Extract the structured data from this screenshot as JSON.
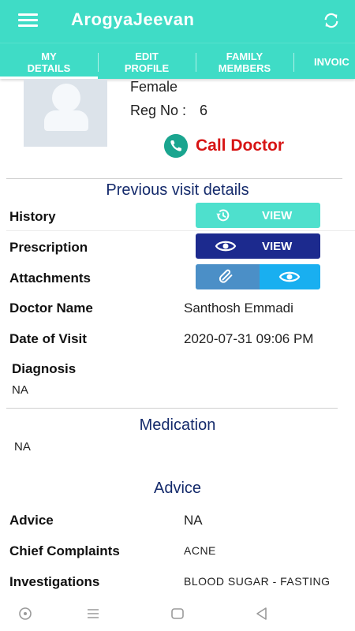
{
  "app": {
    "title": "ArogyaJeevan",
    "accent_color": "#3fdcc6"
  },
  "icons": {
    "menu": "menu-icon",
    "refresh": "refresh-icon",
    "call": "phone-icon",
    "history": "history-icon",
    "view": "eye-icon",
    "attach": "paperclip-icon"
  },
  "tabs": [
    {
      "label": "MY\nDETAILS",
      "selected": true
    },
    {
      "label": "EDIT\nPROFILE",
      "selected": false
    },
    {
      "label": "FAMILY\nMEMBERS",
      "selected": false
    },
    {
      "label": "INVOIC",
      "selected": false
    }
  ],
  "profile": {
    "gender": "Female",
    "reg_label": "Reg No :",
    "reg_value": "6",
    "call_label": "Call Doctor",
    "call_color": "#d71414"
  },
  "previous_visit": {
    "title": "Previous visit details",
    "history_label": "History",
    "history_button": "VIEW",
    "prescription_label": "Prescription",
    "prescription_button": "VIEW",
    "attachments_label": "Attachments",
    "doctor_label": "Doctor Name",
    "doctor_value": "Santhosh Emmadi",
    "date_label": "Date of Visit",
    "date_value": "2020-07-31 09:06 PM",
    "diagnosis_label": "Diagnosis",
    "diagnosis_value": "NA"
  },
  "medication": {
    "title": "Medication",
    "value": "NA"
  },
  "advice": {
    "title": "Advice",
    "advice_label": "Advice",
    "advice_value": "NA",
    "complaints_label": "Chief Complaints",
    "complaints_value": "ACNE",
    "investigations_label": "Investigations",
    "investigations_value": "BLOOD SUGAR - FASTING"
  },
  "nav": {
    "icons": [
      "circle-icon",
      "recents-icon",
      "home-icon",
      "back-icon"
    ]
  }
}
